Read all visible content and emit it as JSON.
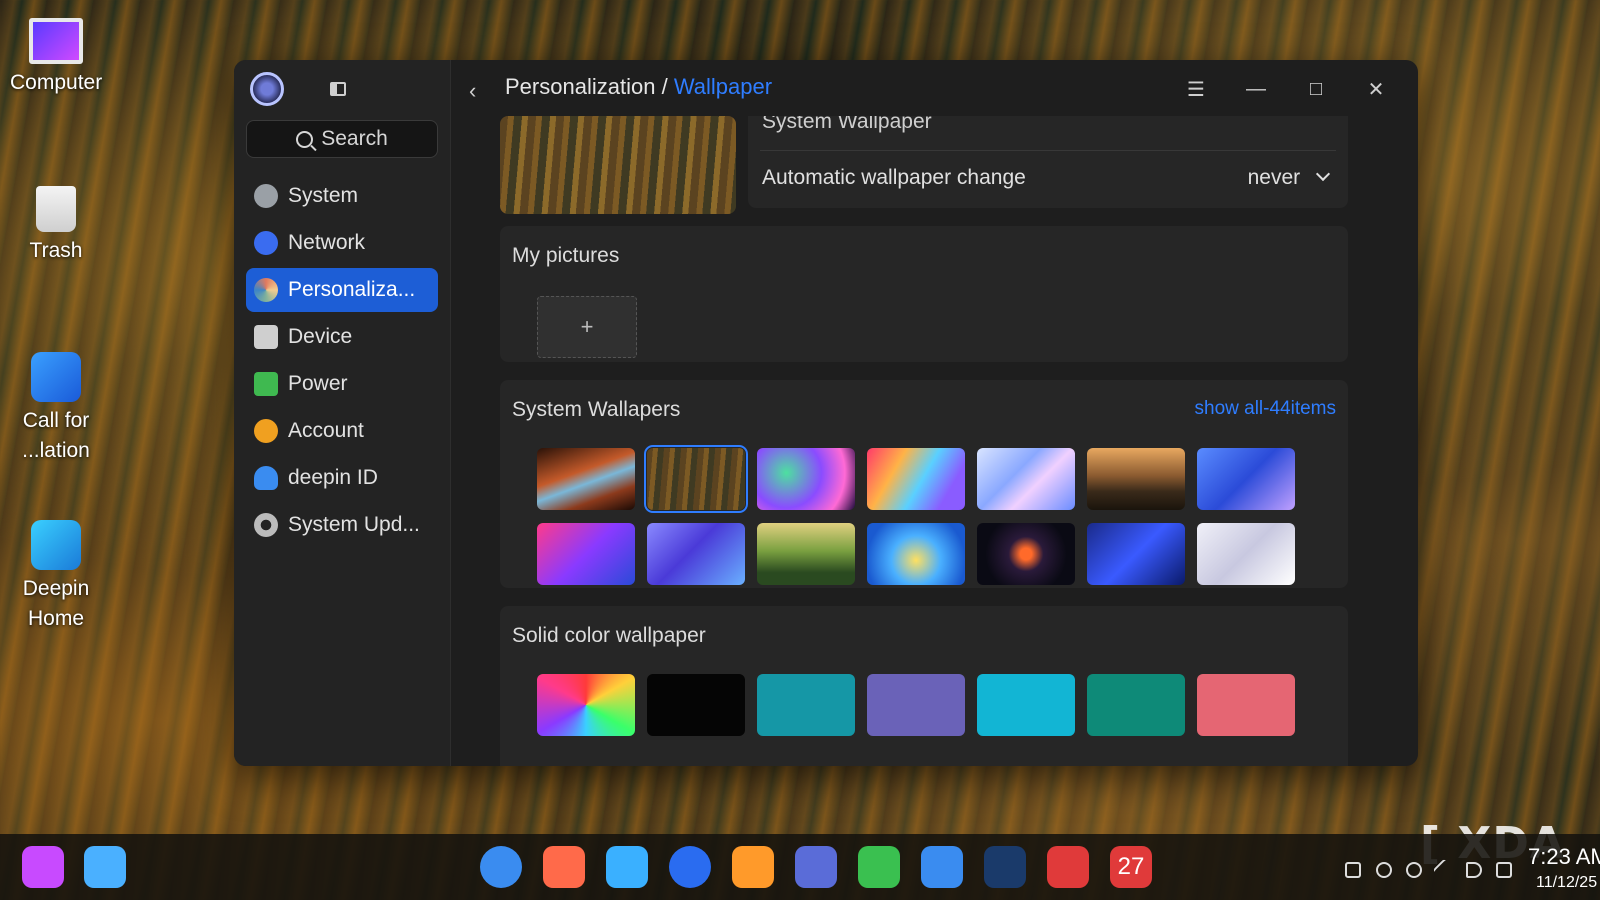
{
  "desktop": {
    "icons": [
      {
        "label": "Computer",
        "icon": "monitor-icon"
      },
      {
        "label": "Trash",
        "icon": "trash-icon"
      },
      {
        "label": "Call for ...lation",
        "icon": "calculator-icon"
      },
      {
        "label": "Deepin Home",
        "icon": "deepin-home-icon"
      }
    ]
  },
  "sidebar": {
    "search_placeholder": "Search",
    "items": [
      {
        "label": "System",
        "icon": "system-icon",
        "color": "#9aa0a6"
      },
      {
        "label": "Network",
        "icon": "network-icon",
        "color": "#3a6cf0"
      },
      {
        "label": "Personaliza...",
        "icon": "personalization-icon",
        "color": "#e07a5f",
        "active": true
      },
      {
        "label": "Device",
        "icon": "device-icon",
        "color": "#cfcfcf"
      },
      {
        "label": "Power",
        "icon": "power-icon",
        "color": "#3fb950"
      },
      {
        "label": "Account",
        "icon": "account-icon",
        "color": "#f0a020"
      },
      {
        "label": "deepin ID",
        "icon": "cloud-icon",
        "color": "#3a8cf0"
      },
      {
        "label": "System Upd...",
        "icon": "update-gear-icon",
        "color": "#bbbbbb"
      }
    ]
  },
  "header": {
    "breadcrumb_parent": "Personalization",
    "breadcrumb_sep": "/",
    "breadcrumb_current": "Wallpaper"
  },
  "wallpaper": {
    "system_wallpaper_label": "System Wallpaper",
    "auto_change_label": "Automatic wallpaper change",
    "auto_change_value": "never",
    "my_pictures_title": "My pictures",
    "add_label": "+",
    "system_wallpapers_title": "System Wallapers",
    "show_all_label": "show all-44items",
    "solid_title": "Solid color wallpaper"
  },
  "accent_color": "#2f7dff",
  "system_wallpapers": [
    "linear-gradient(160deg,#2a1208,#c45a2a 40%,#7ab7d8 55%,#8c3a1c 75%,#1a0a05)",
    "repeating-linear-gradient(95deg,#5b4320 0 6px,#7c5a24 6px 11px,#3f3a22 11px 17px)",
    "radial-gradient(circle at 30% 40%,#4de0a0,#8a4cff 45%,#ff6ad5 75%,#1a0a3a)",
    "linear-gradient(120deg,#ff3a6a,#ffb347 30%,#5ad0ff 55%,#8a5cff 80%)",
    "linear-gradient(135deg,#d9e4ff,#8aa8ff 40%,#f0d0ff 60%,#6a8cff)",
    "linear-gradient(180deg,#e8a860,#8a5a30 45%,#3a2a1a 70%,#1a140c)",
    "linear-gradient(135deg,#5a8cff,#2b4bd8 50%,#c0a0ff)",
    "linear-gradient(135deg,#ff3a8a,#8a3aff 50%,#2a4ad8)",
    "linear-gradient(135deg,#8a8aff,#4a3ad8 45%,#6ab0ff)",
    "linear-gradient(180deg,#e0d080,#7aa040 45%,#2a4a20 80%)",
    "radial-gradient(circle at 50% 60%,#ffe060,#4ab0ff 40%,#1a5ad0 80%)",
    "radial-gradient(circle,#ff6a2a 10%,#2a1a3a 30%,#0a0a14 70%)",
    "linear-gradient(135deg,#1a2a8a,#3a5aff 50%,#0a1a6a)",
    "linear-gradient(135deg,#f0f0f8,#c8c8e0 50%,#ffffff)"
  ],
  "solid_colors": [
    "conic-gradient(from 0deg,#ff3a3a,#ffd03a,#3aff6a,#3ad0ff,#8a3aff,#ff3a8a,#ff3a3a)",
    "#050505",
    "#1597a6",
    "#6a62b8",
    "#12b5d4",
    "#0e8a78",
    "#e56673"
  ],
  "taskbar": {
    "apps": [
      "launcher-icon",
      "search-icon",
      "deepin-icon",
      "screen-record-icon",
      "file-manager-icon",
      "browser-icon",
      "app-store-icon",
      "control-center-icon",
      "music-icon",
      "notes-icon",
      "mail-icon",
      "terminal-icon",
      "calendar-icon"
    ],
    "calendar_day": "27",
    "time": "7:23 AM",
    "date": "11/12/25"
  },
  "watermark": "[ XDA"
}
